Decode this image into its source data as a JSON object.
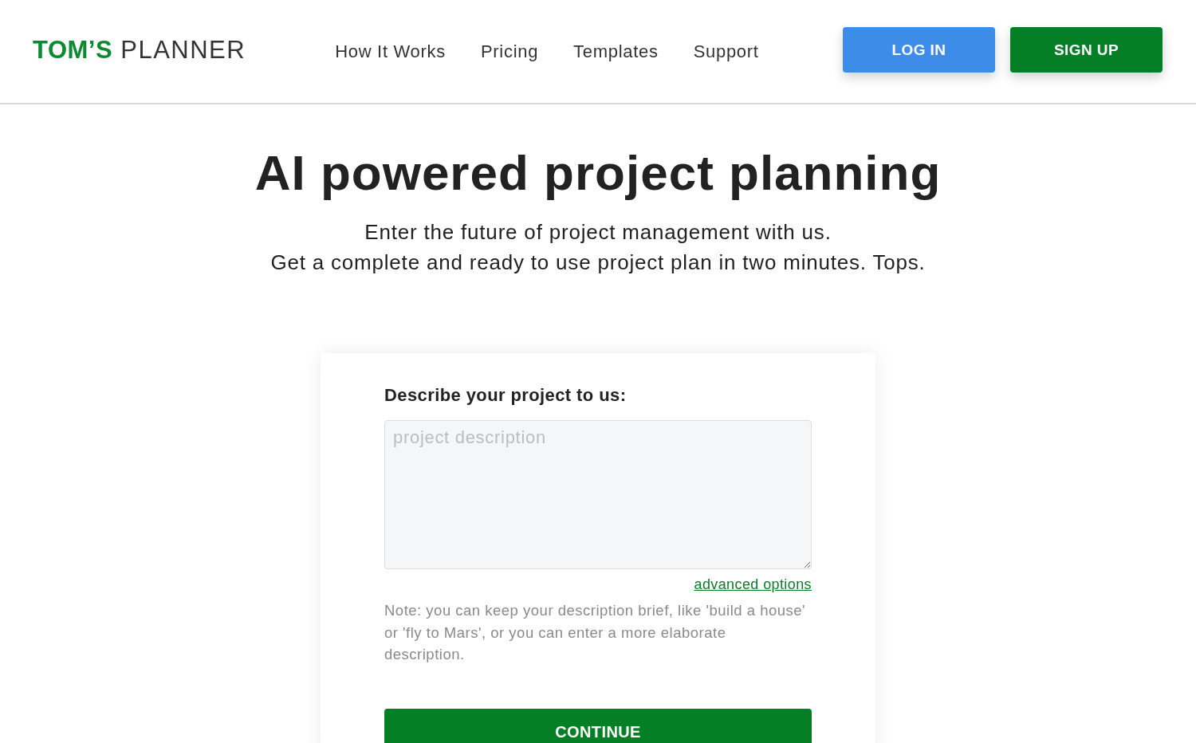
{
  "header": {
    "logo": "**TOM’S** PLANNER",
    "nav": [
      "How It Works",
      "Pricing",
      "Templates",
      "Support"
    ],
    "buttons": [
      {
        "label": "LOG IN",
        "kind": "secondary"
      },
      {
        "label": "SIGN UP",
        "kind": "primary"
      }
    ]
  },
  "hero": {
    "title": "AI powered project planning",
    "subtitle": [
      "Enter the future of project management with us.",
      "Get a complete and ready to use project plan in two minutes. Tops."
    ]
  },
  "form": {
    "label": "Describe your project to us:",
    "description": {
      "placeholder": "project description"
    },
    "advanced_link": "advanced options",
    "note": "Note: you can keep your description brief, like 'build a house' or 'fly to Mars', or you can enter a more elaborate description.",
    "submit": "CONTINUE"
  }
}
